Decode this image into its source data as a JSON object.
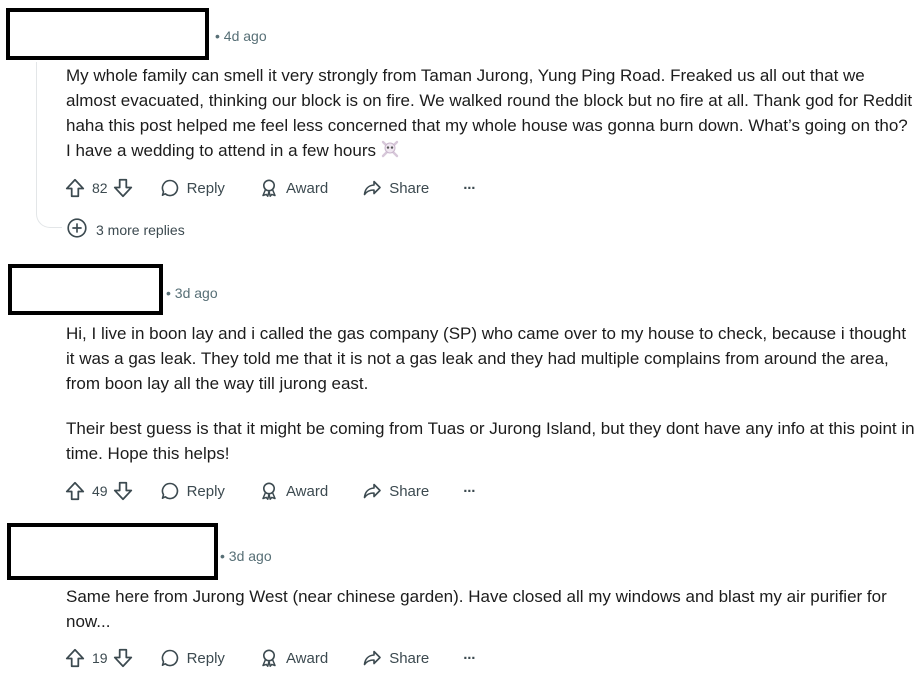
{
  "comments": [
    {
      "time": "• 4d ago",
      "paragraphs": [
        "My whole family can smell it very strongly from Taman Jurong, Yung Ping Road. Freaked us all out that we almost evacuated, thinking our block is on fire. We walked round the block but no fire at all. Thank god for Reddit haha this post helped me feel less concerned that my whole house was gonna burn down. What’s going on tho? I have a wedding to attend in a few hours"
      ],
      "votes": "82",
      "reply_label": "Reply",
      "award_label": "Award",
      "share_label": "Share",
      "more_label": "···",
      "more_replies": "3 more replies"
    },
    {
      "time": "• 3d ago",
      "paragraphs": [
        "Hi, I live in boon lay and i called the gas company (SP) who came over to my house to check, because i thought it was a gas leak. They told me that it is not a gas leak and they had multiple complains from around the area, from boon lay all the way till jurong east.",
        "Their best guess is that it might be coming from Tuas or Jurong Island, but they dont have any info at this point in time. Hope this helps!"
      ],
      "votes": "49",
      "reply_label": "Reply",
      "award_label": "Award",
      "share_label": "Share",
      "more_label": "···"
    },
    {
      "time": "• 3d ago",
      "paragraphs": [
        "Same here from Jurong West (near chinese garden). Have closed all my windows and blast my air purifier for now..."
      ],
      "votes": "19",
      "reply_label": "Reply",
      "award_label": "Award",
      "share_label": "Share",
      "more_label": "···"
    }
  ],
  "icons": {
    "upvote": "upvote-icon",
    "downvote": "downvote-icon",
    "reply": "comment-bubble-icon",
    "award": "award-ribbon-icon",
    "share": "share-arrow-icon",
    "more": "ellipsis-icon",
    "expand": "plus-circle-icon",
    "emoji": "skull-crossbones-emoji"
  }
}
